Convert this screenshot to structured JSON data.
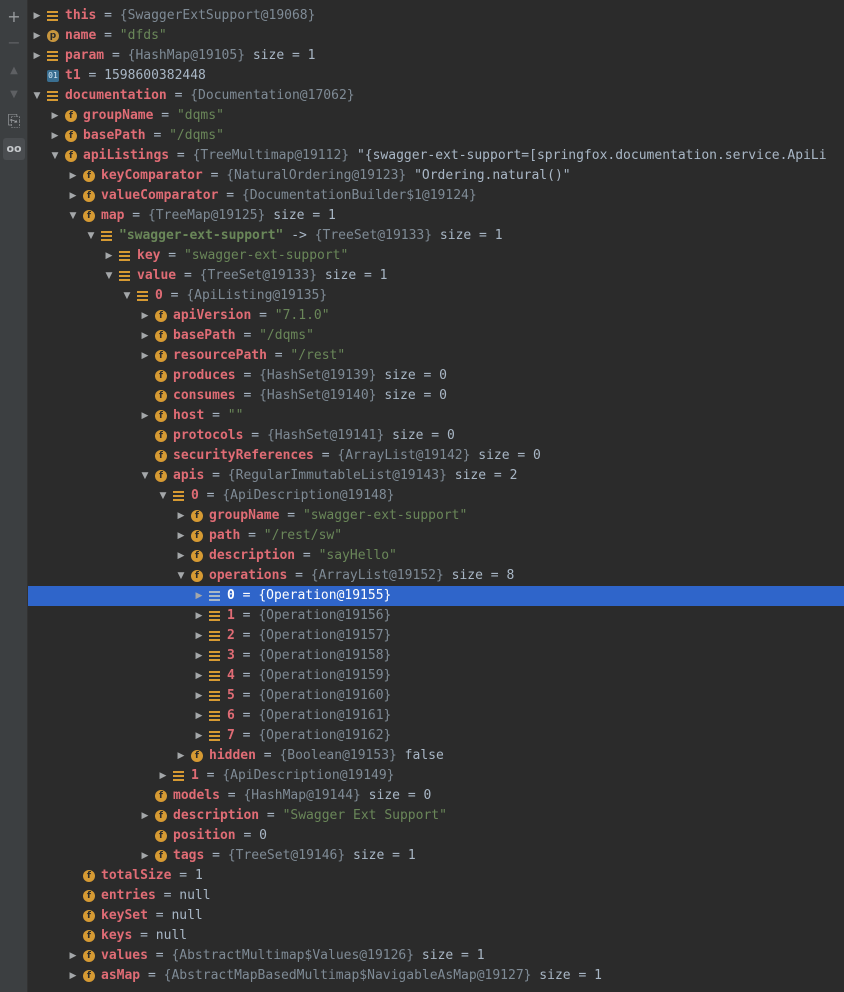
{
  "toolbar": {
    "add_icon": "+",
    "remove_icon": "−",
    "up_icon": "▲",
    "down_icon": "▼",
    "copy_icon": "⎘",
    "watch_icon": "oo"
  },
  "rows": [
    {
      "depth": 0,
      "arrow": "right",
      "icon": "arr",
      "key": "this",
      "sep": " = ",
      "val": "{SwaggerExtSupport@19068}",
      "extra": ""
    },
    {
      "depth": 0,
      "arrow": "right",
      "icon": "p",
      "key": "name",
      "sep": " = ",
      "str": "\"dfds\"",
      "extra": ""
    },
    {
      "depth": 0,
      "arrow": "right",
      "icon": "arr",
      "key": "param",
      "sep": " = ",
      "val": "{HashMap@19105}",
      "extra": "  size = 1"
    },
    {
      "depth": 0,
      "arrow": "none",
      "icon": "prim",
      "key": "t1",
      "sep": " = ",
      "num": "1598600382448",
      "extra": ""
    },
    {
      "depth": 0,
      "arrow": "down",
      "icon": "arr",
      "key": "documentation",
      "sep": " = ",
      "val": "{Documentation@17062}",
      "extra": ""
    },
    {
      "depth": 1,
      "arrow": "right",
      "icon": "f",
      "key": "groupName",
      "sep": " = ",
      "str": "\"dqms\"",
      "extra": ""
    },
    {
      "depth": 1,
      "arrow": "right",
      "icon": "f",
      "key": "basePath",
      "sep": " = ",
      "str": "\"/dqms\"",
      "extra": ""
    },
    {
      "depth": 1,
      "arrow": "down",
      "icon": "f",
      "key": "apiListings",
      "sep": " = ",
      "val": "{TreeMultimap@19112}",
      "extra": " \"{swagger-ext-support=[springfox.documentation.service.ApiLi"
    },
    {
      "depth": 2,
      "arrow": "right",
      "icon": "f",
      "key": "keyComparator",
      "sep": " = ",
      "val": "{NaturalOrdering@19123}",
      "extra": " \"Ordering.natural()\""
    },
    {
      "depth": 2,
      "arrow": "right",
      "icon": "f",
      "key": "valueComparator",
      "sep": " = ",
      "val": "{DocumentationBuilder$1@19124}",
      "extra": ""
    },
    {
      "depth": 2,
      "arrow": "down",
      "icon": "f",
      "key": "map",
      "sep": " = ",
      "val": "{TreeMap@19125}",
      "extra": "  size = 1"
    },
    {
      "depth": 3,
      "arrow": "down",
      "icon": "arr",
      "keystr": "\"swagger-ext-support\"",
      "sep": " -> ",
      "val": "{TreeSet@19133}",
      "extra": "  size = 1"
    },
    {
      "depth": 4,
      "arrow": "right",
      "icon": "arr",
      "key": "key",
      "sep": " = ",
      "str": "\"swagger-ext-support\"",
      "extra": ""
    },
    {
      "depth": 4,
      "arrow": "down",
      "icon": "arr",
      "key": "value",
      "sep": " = ",
      "val": "{TreeSet@19133}",
      "extra": "  size = 1"
    },
    {
      "depth": 5,
      "arrow": "down",
      "icon": "arr",
      "key": "0",
      "sep": " = ",
      "val": "{ApiListing@19135}",
      "extra": ""
    },
    {
      "depth": 6,
      "arrow": "right",
      "icon": "f",
      "key": "apiVersion",
      "sep": " = ",
      "str": "\"7.1.0\"",
      "extra": ""
    },
    {
      "depth": 6,
      "arrow": "right",
      "icon": "f",
      "key": "basePath",
      "sep": " = ",
      "str": "\"/dqms\"",
      "extra": ""
    },
    {
      "depth": 6,
      "arrow": "right",
      "icon": "f",
      "key": "resourcePath",
      "sep": " = ",
      "str": "\"/rest\"",
      "extra": ""
    },
    {
      "depth": 6,
      "arrow": "none",
      "icon": "f",
      "key": "produces",
      "sep": " = ",
      "val": "{HashSet@19139}",
      "extra": "  size = 0"
    },
    {
      "depth": 6,
      "arrow": "none",
      "icon": "f",
      "key": "consumes",
      "sep": " = ",
      "val": "{HashSet@19140}",
      "extra": "  size = 0"
    },
    {
      "depth": 6,
      "arrow": "right",
      "icon": "f",
      "key": "host",
      "sep": " = ",
      "str": "\"\"",
      "extra": ""
    },
    {
      "depth": 6,
      "arrow": "none",
      "icon": "f",
      "key": "protocols",
      "sep": " = ",
      "val": "{HashSet@19141}",
      "extra": "  size = 0"
    },
    {
      "depth": 6,
      "arrow": "none",
      "icon": "f",
      "key": "securityReferences",
      "sep": " = ",
      "val": "{ArrayList@19142}",
      "extra": "  size = 0"
    },
    {
      "depth": 6,
      "arrow": "down",
      "icon": "f",
      "key": "apis",
      "sep": " = ",
      "val": "{RegularImmutableList@19143}",
      "extra": "  size = 2"
    },
    {
      "depth": 7,
      "arrow": "down",
      "icon": "arr",
      "key": "0",
      "sep": " = ",
      "val": "{ApiDescription@19148}",
      "extra": ""
    },
    {
      "depth": 8,
      "arrow": "right",
      "icon": "f",
      "key": "groupName",
      "sep": " = ",
      "str": "\"swagger-ext-support\"",
      "extra": ""
    },
    {
      "depth": 8,
      "arrow": "right",
      "icon": "f",
      "key": "path",
      "sep": " = ",
      "str": "\"/rest/sw\"",
      "extra": ""
    },
    {
      "depth": 8,
      "arrow": "right",
      "icon": "f",
      "key": "description",
      "sep": " = ",
      "str": "\"sayHello\"",
      "extra": ""
    },
    {
      "depth": 8,
      "arrow": "down",
      "icon": "f",
      "key": "operations",
      "sep": " = ",
      "val": "{ArrayList@19152}",
      "extra": "  size = 8"
    },
    {
      "depth": 9,
      "arrow": "right",
      "icon": "sel",
      "key": "0",
      "sep": " = ",
      "val": "{Operation@19155}",
      "extra": "",
      "selected": true
    },
    {
      "depth": 9,
      "arrow": "right",
      "icon": "arr",
      "key": "1",
      "sep": " = ",
      "val": "{Operation@19156}",
      "extra": ""
    },
    {
      "depth": 9,
      "arrow": "right",
      "icon": "arr",
      "key": "2",
      "sep": " = ",
      "val": "{Operation@19157}",
      "extra": ""
    },
    {
      "depth": 9,
      "arrow": "right",
      "icon": "arr",
      "key": "3",
      "sep": " = ",
      "val": "{Operation@19158}",
      "extra": ""
    },
    {
      "depth": 9,
      "arrow": "right",
      "icon": "arr",
      "key": "4",
      "sep": " = ",
      "val": "{Operation@19159}",
      "extra": ""
    },
    {
      "depth": 9,
      "arrow": "right",
      "icon": "arr",
      "key": "5",
      "sep": " = ",
      "val": "{Operation@19160}",
      "extra": ""
    },
    {
      "depth": 9,
      "arrow": "right",
      "icon": "arr",
      "key": "6",
      "sep": " = ",
      "val": "{Operation@19161}",
      "extra": ""
    },
    {
      "depth": 9,
      "arrow": "right",
      "icon": "arr",
      "key": "7",
      "sep": " = ",
      "val": "{Operation@19162}",
      "extra": ""
    },
    {
      "depth": 8,
      "arrow": "right",
      "icon": "f",
      "key": "hidden",
      "sep": " = ",
      "val": "{Boolean@19153}",
      "extra": " false"
    },
    {
      "depth": 7,
      "arrow": "right",
      "icon": "arr",
      "key": "1",
      "sep": " = ",
      "val": "{ApiDescription@19149}",
      "extra": ""
    },
    {
      "depth": 6,
      "arrow": "none",
      "icon": "f",
      "key": "models",
      "sep": " = ",
      "val": "{HashMap@19144}",
      "extra": "  size = 0"
    },
    {
      "depth": 6,
      "arrow": "right",
      "icon": "f",
      "key": "description",
      "sep": " = ",
      "str": "\"Swagger Ext Support\"",
      "extra": ""
    },
    {
      "depth": 6,
      "arrow": "none",
      "icon": "f",
      "key": "position",
      "sep": " = ",
      "num": "0",
      "extra": ""
    },
    {
      "depth": 6,
      "arrow": "right",
      "icon": "f",
      "key": "tags",
      "sep": " = ",
      "val": "{TreeSet@19146}",
      "extra": "  size = 1"
    },
    {
      "depth": 2,
      "arrow": "none",
      "icon": "f",
      "key": "totalSize",
      "sep": " = ",
      "num": "1",
      "extra": ""
    },
    {
      "depth": 2,
      "arrow": "none",
      "icon": "f",
      "key": "entries",
      "sep": " = ",
      "num": "null",
      "extra": ""
    },
    {
      "depth": 2,
      "arrow": "none",
      "icon": "f",
      "key": "keySet",
      "sep": " = ",
      "num": "null",
      "extra": ""
    },
    {
      "depth": 2,
      "arrow": "none",
      "icon": "f",
      "key": "keys",
      "sep": " = ",
      "num": "null",
      "extra": ""
    },
    {
      "depth": 2,
      "arrow": "right",
      "icon": "f",
      "key": "values",
      "sep": " = ",
      "val": "{AbstractMultimap$Values@19126}",
      "extra": "  size = 1"
    },
    {
      "depth": 2,
      "arrow": "right",
      "icon": "f",
      "key": "asMap",
      "sep": " = ",
      "val": "{AbstractMapBasedMultimap$NavigableAsMap@19127}",
      "extra": "  size = 1"
    }
  ],
  "icon_letters": {
    "f": "f",
    "p": "p",
    "prim": "01"
  },
  "colors": {
    "background": "#2b2b2b",
    "selection": "#2f65ca",
    "field_key": "#e06c75",
    "string": "#6a8759",
    "object_ref": "#7f8b96",
    "icon_orange": "#d69a33"
  }
}
